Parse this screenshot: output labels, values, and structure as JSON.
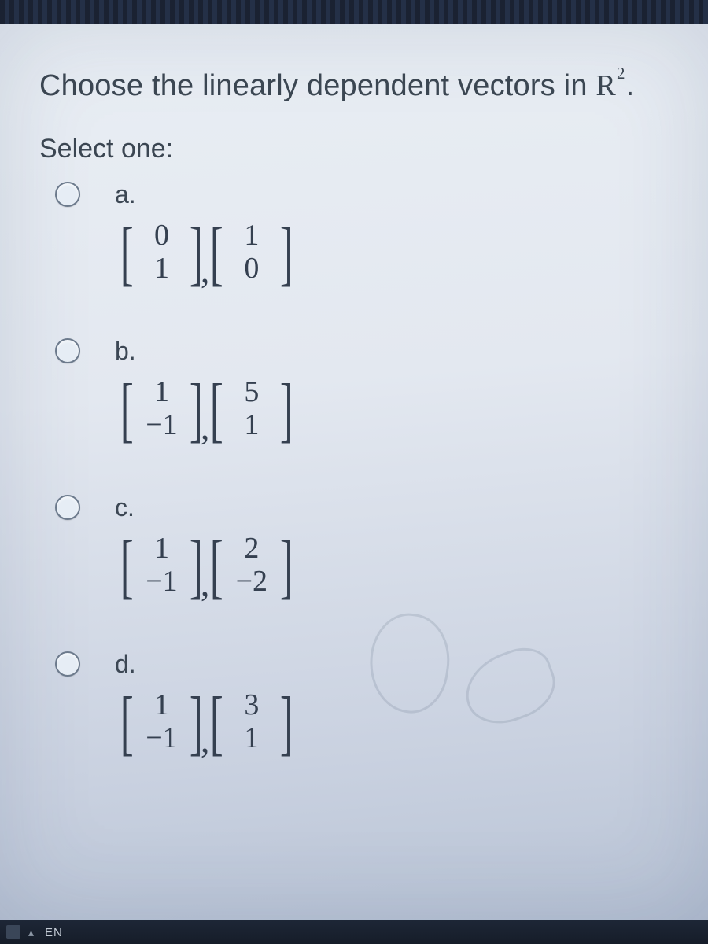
{
  "question": {
    "prefix": "Choose the linearly dependent vectors in ",
    "space_exp": "2",
    "suffix": "."
  },
  "select_label": "Select one:",
  "options": [
    {
      "letter": "a.",
      "m1": {
        "top": "0",
        "bot": "1"
      },
      "m2": {
        "top": "1",
        "bot": "0"
      }
    },
    {
      "letter": "b.",
      "m1": {
        "top": "1",
        "bot": "−1"
      },
      "m2": {
        "top": "5",
        "bot": "1"
      }
    },
    {
      "letter": "c.",
      "m1": {
        "top": "1",
        "bot": "−1"
      },
      "m2": {
        "top": "2",
        "bot": "−2"
      }
    },
    {
      "letter": "d.",
      "m1": {
        "top": "1",
        "bot": "−1"
      },
      "m2": {
        "top": "3",
        "bot": "1"
      }
    }
  ],
  "footer": {
    "lang": "EN",
    "arrow": "▴"
  }
}
